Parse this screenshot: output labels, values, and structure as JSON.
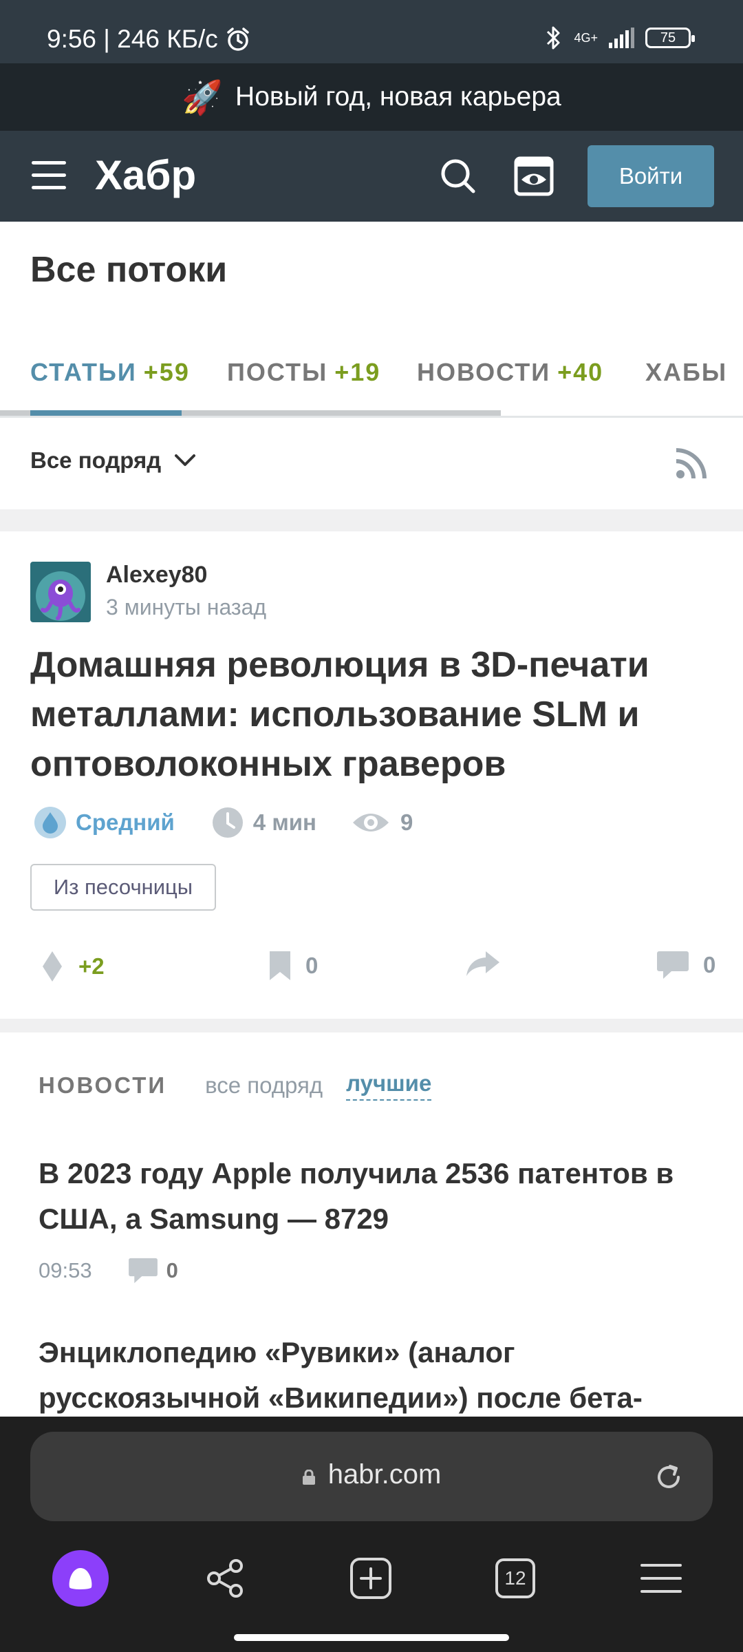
{
  "status_bar": {
    "time_speed": "9:56 | 246 КБ/с",
    "network": "4G+",
    "battery": "75"
  },
  "promo": {
    "text": "Новый год, новая карьера"
  },
  "header": {
    "logo": "Хабр",
    "login_label": "Войти"
  },
  "page_title": "Все потоки",
  "tabs": [
    {
      "label": "СТАТЬИ",
      "count": "+59"
    },
    {
      "label": "ПОСТЫ",
      "count": "+19"
    },
    {
      "label": "НОВОСТИ",
      "count": "+40"
    },
    {
      "label": "ХАБЫ",
      "count": ""
    }
  ],
  "filter": {
    "label": "Все подряд"
  },
  "article": {
    "author": "Alexey80",
    "time_ago": "3 минуты назад",
    "title": "Домашняя революция в 3D-печати металлами: использование SLM и оптоволоконных граверов",
    "complexity": "Средний",
    "read_time": "4 мин",
    "views": "9",
    "sandbox_label": "Из песочницы",
    "rating": "+2",
    "bookmarks": "0",
    "comments": "0"
  },
  "news": {
    "label": "НОВОСТИ",
    "filter_all": "все подряд",
    "filter_best": "лучшие",
    "items": [
      {
        "title": "В 2023 году Apple получила 2536 патентов в США, а Samsung — 8729",
        "time": "09:53",
        "comments": "0"
      },
      {
        "title": "Энциклопедию «Рувики» (аналог русскоязычной «Википедии») после бета-"
      }
    ]
  },
  "browser": {
    "url": "habr.com",
    "tabs_count": "12"
  },
  "colors": {
    "header_bg": "#303b44",
    "accent": "#548eaa",
    "positive": "#7b9d1f",
    "alice": "#8c3ffa"
  }
}
